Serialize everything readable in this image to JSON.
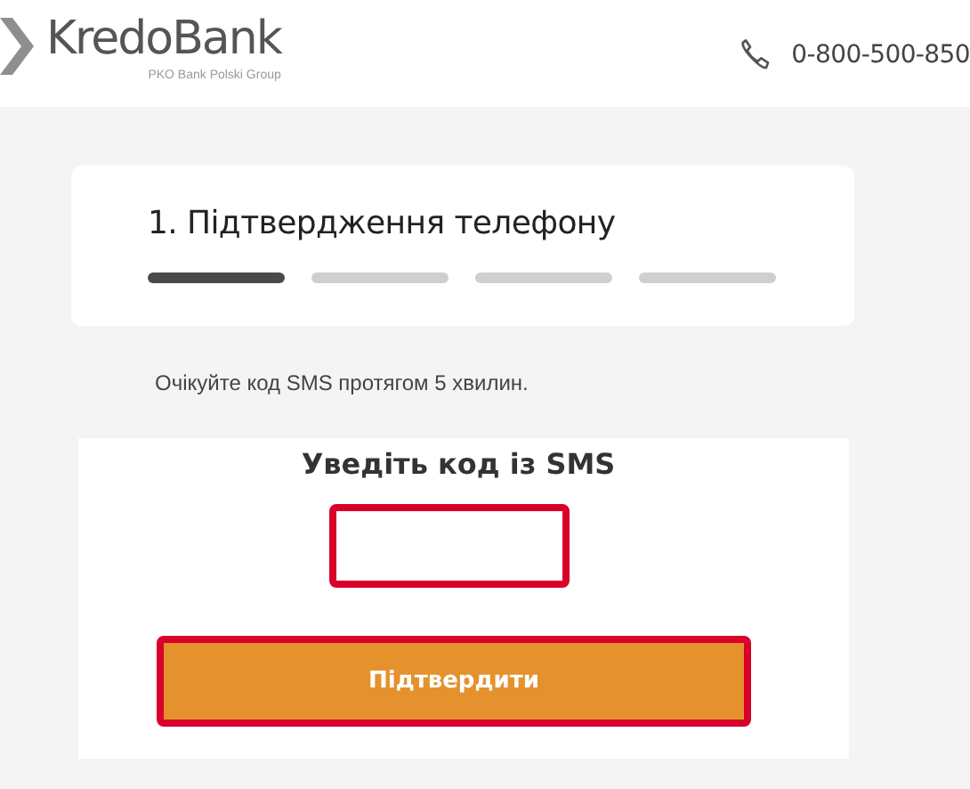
{
  "header": {
    "logo": {
      "name": "KredoBank",
      "tagline": "PKO Bank Polski Group"
    },
    "phone": "0-800-500-850"
  },
  "step_card": {
    "title": "1. Підтвердження телефону",
    "steps": [
      {
        "selected": true
      },
      {
        "selected": false
      },
      {
        "selected": false
      },
      {
        "selected": false
      }
    ]
  },
  "hint": "Очікуйте код SMS протягом 5 хвилин.",
  "code_form": {
    "title": "Уведіть код із SMS",
    "code_field": {
      "invalid": true
    },
    "submit": {
      "label": "Підтвердити",
      "highlighted": true
    }
  }
}
